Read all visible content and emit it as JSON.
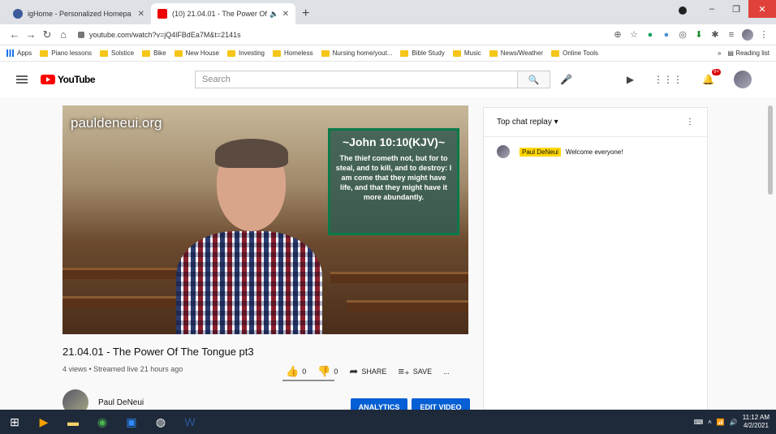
{
  "browser": {
    "tabs": [
      {
        "title": "igHome - Personalized Homepa",
        "active": false
      },
      {
        "title": "(10) 21.04.01 - The Power Of",
        "active": true
      }
    ],
    "url": "youtube.com/watch?v=jQ4lFBdEa7M&t=2141s",
    "bookmarks": [
      "Apps",
      "Piano lessons",
      "Solstice",
      "Bike",
      "New House",
      "Investing",
      "Homeless",
      "Nursing home/yout...",
      "Bible Study",
      "Music",
      "News/Weather",
      "Online Tools"
    ],
    "reading_list": "Reading list",
    "more_bookmarks": "»"
  },
  "youtube": {
    "logo": "YouTube",
    "search_placeholder": "Search",
    "notifications_badge": "9+"
  },
  "video": {
    "watermark": "pauldeneui.org",
    "verse_ref": "~John 10:10(KJV)~",
    "verse_text": "The thief cometh not, but for to steal, and to kill, and to destroy: I am come that they might have life, and that they might have it more abundantly.",
    "title": "21.04.01 - The Power Of The Tongue pt3",
    "meta": "4 views • Streamed live 21 hours ago",
    "likes": "0",
    "dislikes": "0",
    "share": "SHARE",
    "save": "SAVE",
    "more": "...",
    "channel": "Paul DeNeui",
    "analytics": "ANALYTICS",
    "edit": "EDIT VIDEO"
  },
  "chat": {
    "header": "Top chat replay",
    "messages": [
      {
        "author": "Paul DeNeui",
        "text": "Welcome everyone!"
      }
    ]
  },
  "taskbar": {
    "time": "11:12 AM",
    "date": "4/2/2021"
  }
}
